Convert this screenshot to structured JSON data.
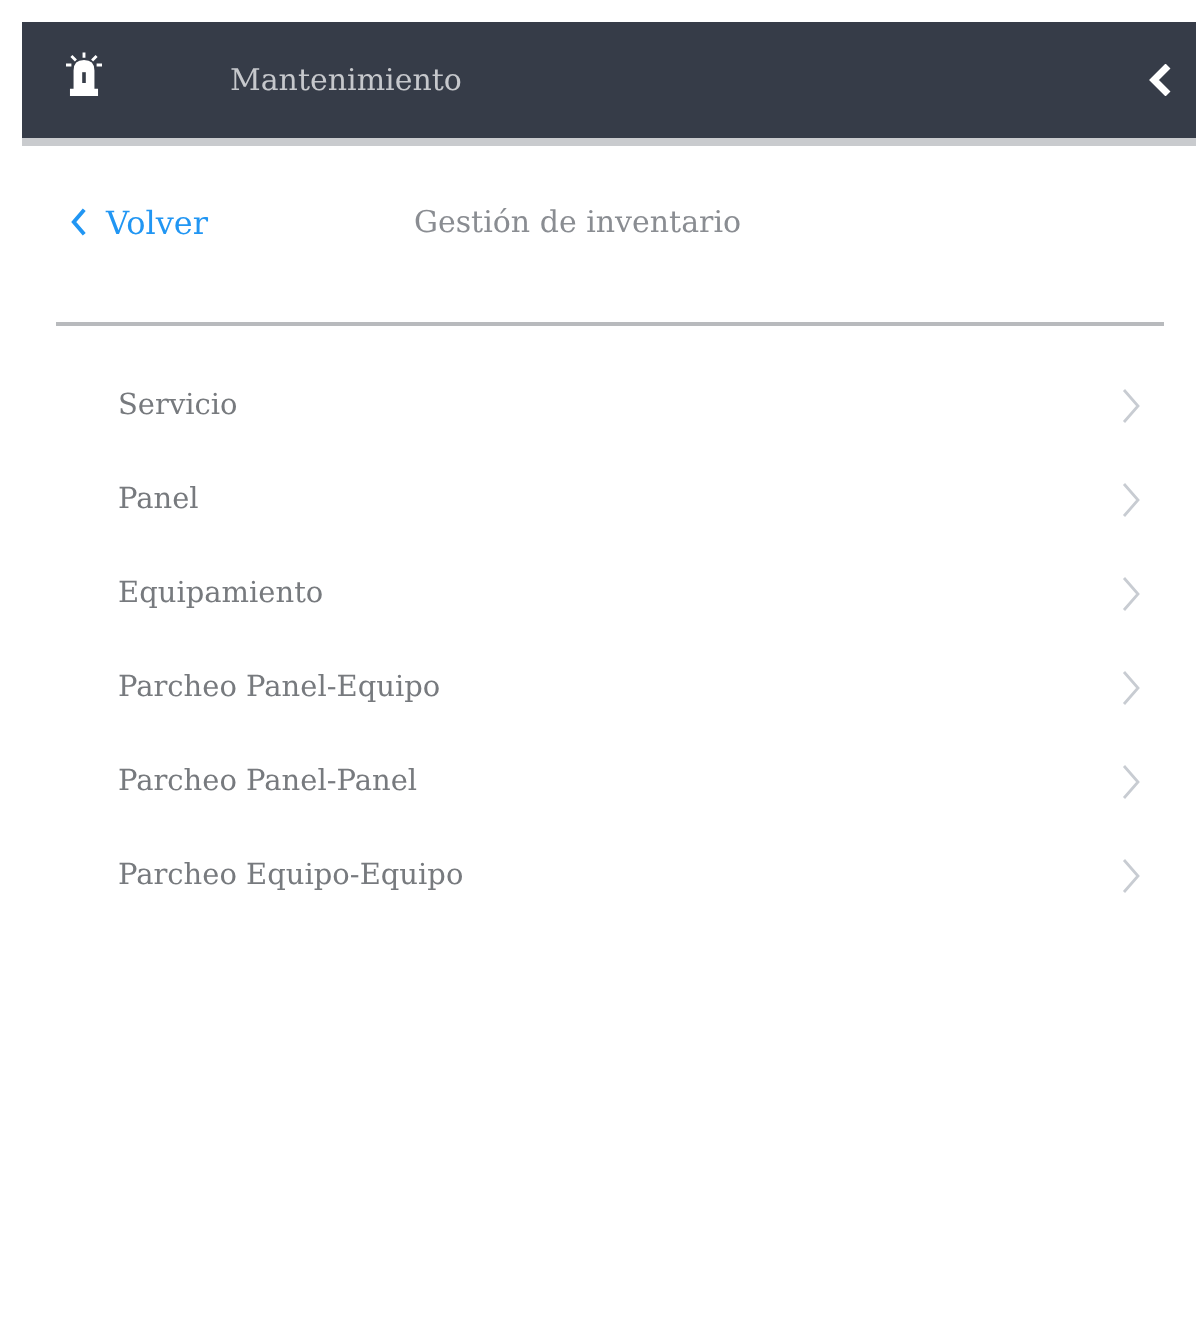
{
  "header": {
    "title": "Mantenimiento"
  },
  "nav": {
    "back": "Volver",
    "title": "Gestión de inventario"
  },
  "menu": [
    {
      "label": "Servicio"
    },
    {
      "label": "Panel"
    },
    {
      "label": "Equipamiento"
    },
    {
      "label": "Parcheo Panel-Equipo"
    },
    {
      "label": "Parcheo Panel-Panel"
    },
    {
      "label": "Parcheo Equipo-Equipo"
    }
  ]
}
